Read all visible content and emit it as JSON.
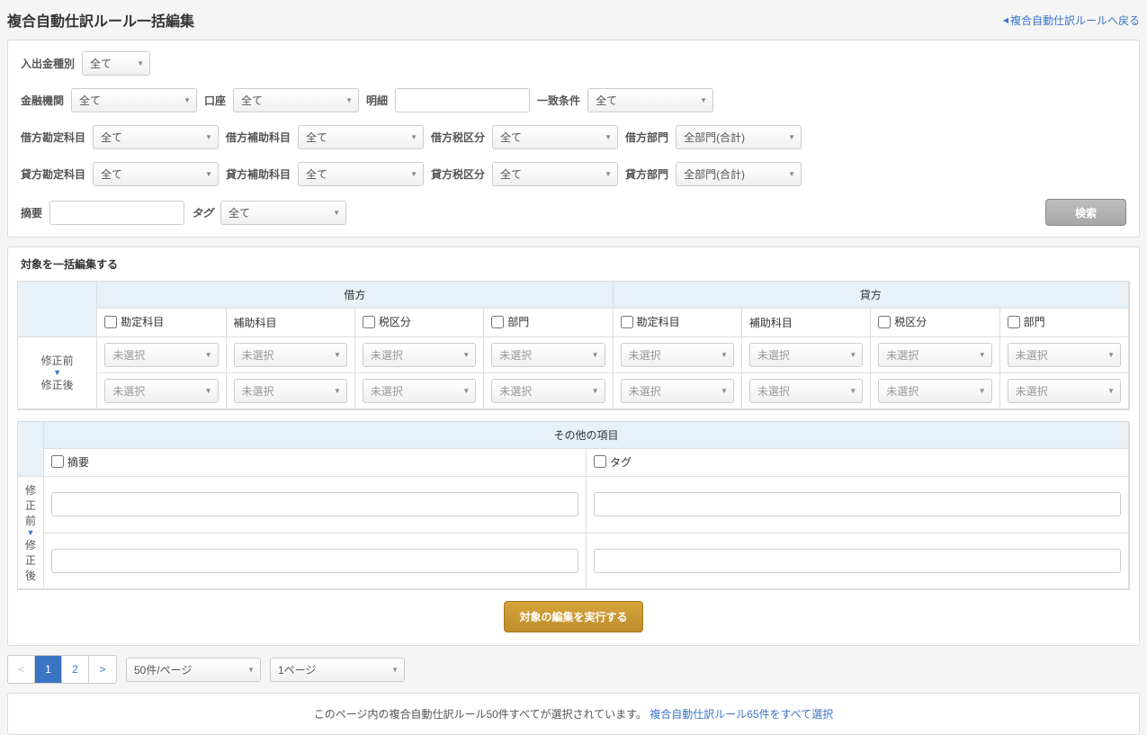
{
  "header": {
    "title": "複合自動仕訳ルール一括編集",
    "back_link": "複合自動仕訳ルールへ戻る"
  },
  "filters": {
    "type_label": "入出金種別",
    "type_value": "全て",
    "institution_label": "金融機関",
    "institution_value": "全て",
    "account_label": "口座",
    "account_value": "全て",
    "detail_label": "明細",
    "match_label": "一致条件",
    "match_value": "全て",
    "dr_item_label": "借方勘定科目",
    "dr_item_value": "全て",
    "dr_sub_label": "借方補助科目",
    "dr_sub_value": "全て",
    "dr_tax_label": "借方税区分",
    "dr_tax_value": "全て",
    "dr_dept_label": "借方部門",
    "dr_dept_value": "全部門(合計)",
    "cr_item_label": "貸方勘定科目",
    "cr_item_value": "全て",
    "cr_sub_label": "貸方補助科目",
    "cr_sub_value": "全て",
    "cr_tax_label": "貸方税区分",
    "cr_tax_value": "全て",
    "cr_dept_label": "貸方部門",
    "cr_dept_value": "全部門(合計)",
    "summary_label": "摘要",
    "tag_label": "タグ",
    "tag_value": "全て",
    "search_btn": "検索"
  },
  "bulk": {
    "section_title": "対象を一括編集する",
    "dr_header": "借方",
    "cr_header": "貸方",
    "col_item": "勘定科目",
    "col_sub": "補助科目",
    "col_tax": "税区分",
    "col_dept": "部門",
    "row_before": "修正前",
    "row_after": "修正後",
    "unselected": "未選択",
    "other_header": "その他の項目",
    "col_summary": "摘要",
    "col_tag": "タグ",
    "execute_btn": "対象の編集を実行する"
  },
  "pagination": {
    "prev": "<",
    "p1": "1",
    "p2": "2",
    "next": ">",
    "per_page": "50件/ページ",
    "goto_page": "1ページ",
    "info_text": "このページ内の複合自動仕訳ルール50件すべてが選択されています。",
    "select_all_link": "複合自動仕訳ルール65件をすべて選択"
  }
}
